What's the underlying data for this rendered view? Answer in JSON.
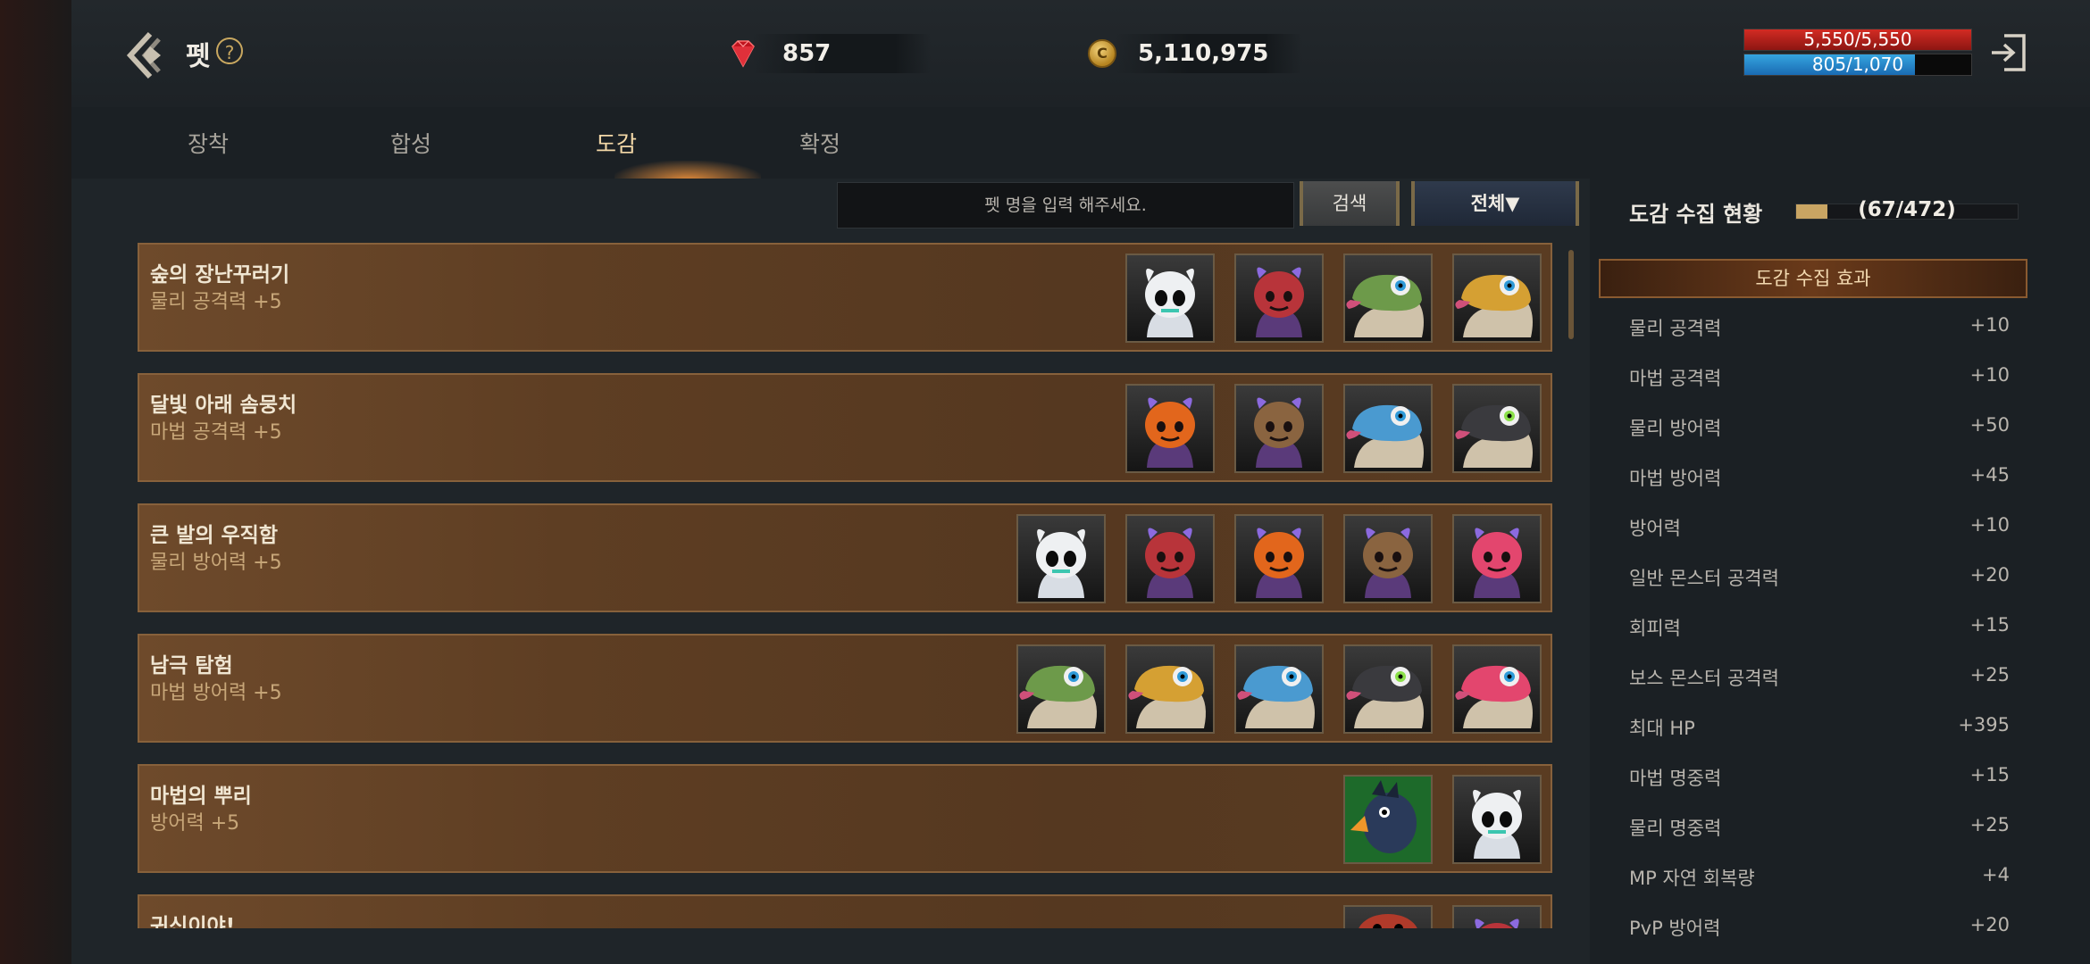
{
  "header": {
    "title": "펫",
    "help_glyph": "?",
    "ruby": "857",
    "gold": "5,110,975",
    "hp_text": "5,550/5,550",
    "hp_fraction": 1.0,
    "mp_text": "805/1,070",
    "mp_fraction": 0.752,
    "coin_glyph": "C"
  },
  "tabs": [
    "장착",
    "합성",
    "도감",
    "확정"
  ],
  "active_tab": 2,
  "search": {
    "placeholder": "펫 명을 입력 해주세요.",
    "button_label": "검색",
    "filter_label": "전체▼"
  },
  "collections": [
    {
      "name": "숲의 장난꾸러기",
      "bonus": "물리 공격력 +5",
      "pets": [
        "skull-white",
        "devil-plaid",
        "lizard-green",
        "lizard-yellow"
      ]
    },
    {
      "name": "달빛 아래 솜뭉치",
      "bonus": "마법 공격력 +5",
      "pets": [
        "devil-orange",
        "devil-brown",
        "lizard-blue",
        "lizard-dark"
      ]
    },
    {
      "name": "큰 발의 우직함",
      "bonus": "물리 방어력 +5",
      "pets": [
        "skull-white",
        "devil-plaid",
        "devil-orange",
        "devil-brown",
        "devil-pink"
      ]
    },
    {
      "name": "남극 탐험",
      "bonus": "마법 방어력 +5",
      "pets": [
        "lizard-green",
        "lizard-yellow",
        "lizard-blue",
        "lizard-dark",
        "lizard-pink"
      ]
    },
    {
      "name": "마법의 뿌리",
      "bonus": "방어력 +5",
      "pets": [
        "bird-blue",
        "skull-white"
      ]
    },
    {
      "name": "귀신이야!",
      "bonus": "",
      "pets": [
        "crab-red",
        "devil-plaid"
      ]
    }
  ],
  "collection_status": {
    "title": "도감 수집 현황",
    "count_text": "(67/472)",
    "fraction": 0.142
  },
  "effects": {
    "header": "도감 수집 효과",
    "items": [
      {
        "label": "물리 공격력",
        "value": "+10"
      },
      {
        "label": "마법 공격력",
        "value": "+10"
      },
      {
        "label": "물리 방어력",
        "value": "+50"
      },
      {
        "label": "마법 방어력",
        "value": "+45"
      },
      {
        "label": "방어력",
        "value": "+10"
      },
      {
        "label": "일반 몬스터 공격력",
        "value": "+20"
      },
      {
        "label": "회피력",
        "value": "+15"
      },
      {
        "label": "보스 몬스터 공격력",
        "value": "+25"
      },
      {
        "label": "최대 HP",
        "value": "+395"
      },
      {
        "label": "마법 명중력",
        "value": "+15"
      },
      {
        "label": "물리 명중력",
        "value": "+25"
      },
      {
        "label": "MP 자연 회복량",
        "value": "+4"
      },
      {
        "label": "PvP 방어력",
        "value": "+20"
      }
    ]
  },
  "colors": {
    "accent_gold": "#c9a563",
    "hp_red": "#d22b23",
    "mp_blue": "#35a4e0",
    "card_brown": "#5e3e23"
  }
}
